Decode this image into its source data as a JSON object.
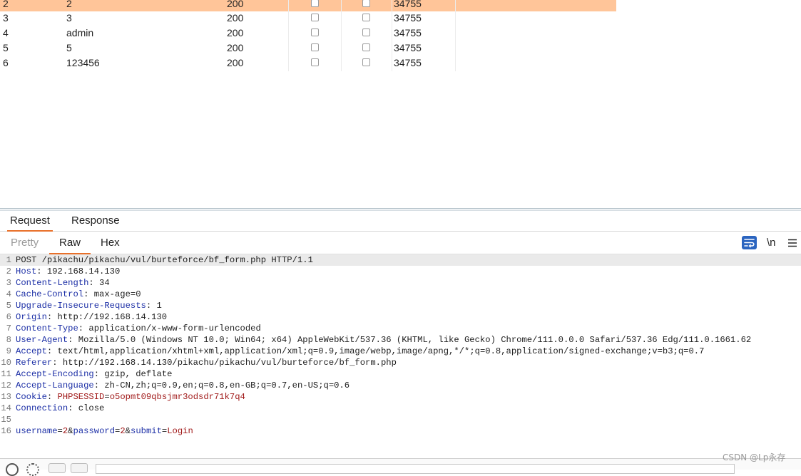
{
  "results_table": {
    "rows": [
      {
        "num": "2",
        "payload": "2",
        "status": "200",
        "length": "34755",
        "selected": true
      },
      {
        "num": "3",
        "payload": "3",
        "status": "200",
        "length": "34755",
        "selected": false
      },
      {
        "num": "4",
        "payload": "admin",
        "status": "200",
        "length": "34755",
        "selected": false
      },
      {
        "num": "5",
        "payload": "5",
        "status": "200",
        "length": "34755",
        "selected": false
      },
      {
        "num": "6",
        "payload": "123456",
        "status": "200",
        "length": "34755",
        "selected": false
      }
    ]
  },
  "main_tabs": [
    {
      "label": "Request",
      "active": true
    },
    {
      "label": "Response",
      "active": false
    }
  ],
  "editor_tabs": [
    {
      "label": "Pretty",
      "active": false
    },
    {
      "label": "Raw",
      "active": true
    },
    {
      "label": "Hex",
      "active": false
    }
  ],
  "toolbar": {
    "wrap_icon": "wrap-lines-icon",
    "newline_label": "\\n",
    "menu_icon": "hamburger-menu-icon"
  },
  "request_lines": [
    {
      "n": "1",
      "text": "POST /pikachu/pikachu/vul/burteforce/bf_form.php HTTP/1.1"
    },
    {
      "n": "2",
      "key": "Host",
      "value": " 192.168.14.130"
    },
    {
      "n": "3",
      "key": "Content-Length",
      "value": " 34"
    },
    {
      "n": "4",
      "key": "Cache-Control",
      "value": " max-age=0"
    },
    {
      "n": "5",
      "key": "Upgrade-Insecure-Requests",
      "value": " 1"
    },
    {
      "n": "6",
      "key": "Origin",
      "value": " http://192.168.14.130"
    },
    {
      "n": "7",
      "key": "Content-Type",
      "value": " application/x-www-form-urlencoded"
    },
    {
      "n": "8",
      "key": "User-Agent",
      "value": " Mozilla/5.0 (Windows NT 10.0; Win64; x64) AppleWebKit/537.36 (KHTML, like Gecko) Chrome/111.0.0.0 Safari/537.36 Edg/111.0.1661.62"
    },
    {
      "n": "9",
      "key": "Accept",
      "value": " text/html,application/xhtml+xml,application/xml;q=0.9,image/webp,image/apng,*/*;q=0.8,application/signed-exchange;v=b3;q=0.7"
    },
    {
      "n": "10",
      "key": "Referer",
      "value": " http://192.168.14.130/pikachu/pikachu/vul/burteforce/bf_form.php"
    },
    {
      "n": "11",
      "key": "Accept-Encoding",
      "value": " gzip, deflate"
    },
    {
      "n": "12",
      "key": "Accept-Language",
      "value": " zh-CN,zh;q=0.9,en;q=0.8,en-GB;q=0.7,en-US;q=0.6"
    },
    {
      "n": "13",
      "key": "Cookie",
      "cookie_name": "PHPSESSID",
      "cookie_value": "o5opmt09qbsjmr3odsdr71k7q4"
    },
    {
      "n": "14",
      "key": "Connection",
      "value": " close"
    },
    {
      "n": "15"
    },
    {
      "n": "16",
      "body": [
        {
          "k": "username"
        },
        {
          "s": "="
        },
        {
          "v": "2"
        },
        {
          "s": "&"
        },
        {
          "k": "password"
        },
        {
          "s": "="
        },
        {
          "v": "2"
        },
        {
          "s": "&"
        },
        {
          "k": "submit"
        },
        {
          "s": "="
        },
        {
          "v": "Login"
        }
      ]
    }
  ],
  "watermark": "CSDN @Lp永存"
}
